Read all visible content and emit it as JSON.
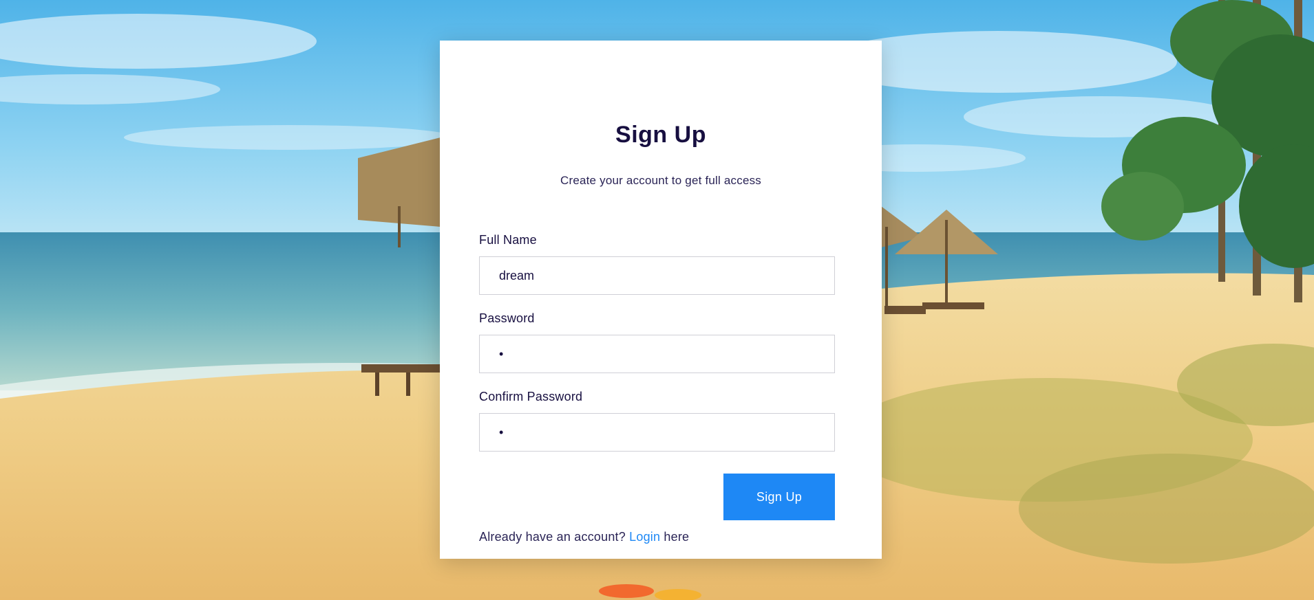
{
  "page": {
    "title": "Sign Up",
    "subtitle": "Create your account to get full access"
  },
  "form": {
    "full_name": {
      "label": "Full Name",
      "value": "dream"
    },
    "password": {
      "label": "Password",
      "value": "•"
    },
    "confirm_password": {
      "label": "Confirm Password",
      "value": "•"
    }
  },
  "footer": {
    "prompt": "Already have an account?",
    "link_label": "Login",
    "suffix": "here",
    "submit_label": "Sign Up"
  },
  "colors": {
    "accent": "#1e88f5",
    "heading": "#170f40",
    "card_background": "#ffffff"
  }
}
